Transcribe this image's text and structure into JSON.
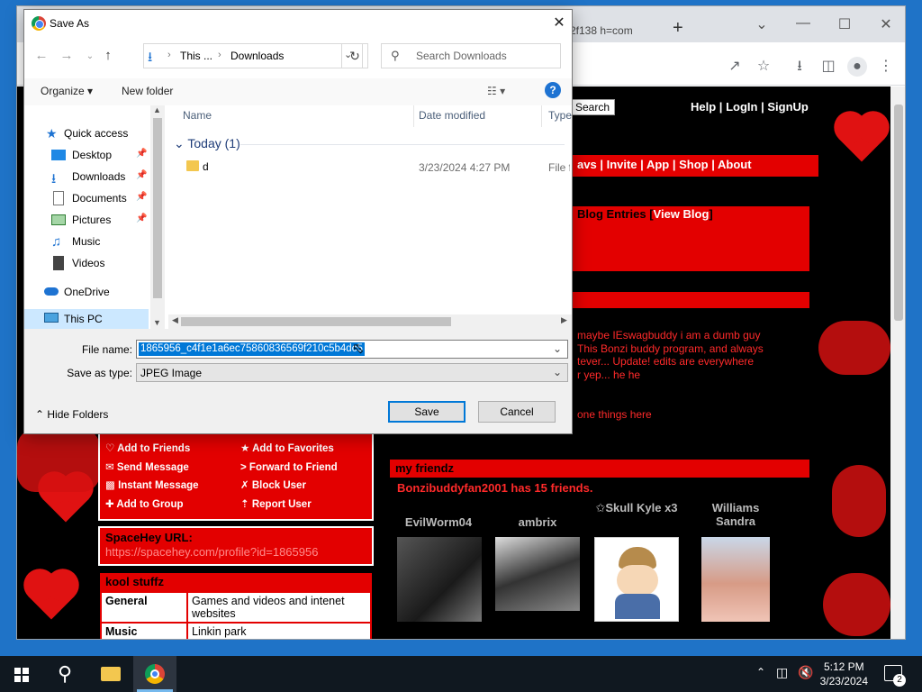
{
  "browser": {
    "tab_title": "2f138 h=com",
    "new_tab": "+"
  },
  "page": {
    "search_button": "Search",
    "top_links": [
      "Help",
      "LogIn",
      "SignUp"
    ],
    "top_sep": "|",
    "nav_links": [
      "avs",
      "Invite",
      "App",
      "Shop",
      "About"
    ],
    "blog_heading": "Blog Entries",
    "view_blog": "View Blog",
    "blurb_lines": [
      "maybe IEswagbuddy i am a dumb guy",
      "This Bonzi buddy program, and always",
      "tever... Update! edits are everywhere",
      "r yep... he he"
    ],
    "blurb_extra": "one things here",
    "contact": {
      "left": [
        "Add to Friends",
        "Send Message",
        "Instant Message",
        "Add to Group"
      ],
      "right": [
        "Add to Favorites",
        "Forward to Friend",
        "Block User",
        "Report User"
      ]
    },
    "url_box": {
      "label": "SpaceHey URL:",
      "url": "https://spacehey.com/profile?id=1865956"
    },
    "kool": {
      "heading": "kool stuffz",
      "rows": [
        {
          "key": "General",
          "value": "Games and videos and intenet websites"
        },
        {
          "key": "Music",
          "value": "Linkin park"
        }
      ]
    },
    "friends": {
      "heading": "my friendz",
      "count_text": "Bonzibuddyfan2001 has 15 friends.",
      "names": [
        "EvilWorm04",
        "ambrix",
        "✩Skull Kyle x3",
        "Williams Sandra"
      ]
    }
  },
  "dialog": {
    "title": "Save As",
    "close": "✕",
    "breadcrumb": [
      "This ...",
      "Downloads"
    ],
    "search_placeholder": "Search Downloads",
    "organize": "Organize",
    "new_folder": "New folder",
    "nav_items": [
      {
        "label": "Quick access",
        "icon": "star-icon"
      },
      {
        "label": "Desktop",
        "icon": "desktop-icon",
        "pinned": true
      },
      {
        "label": "Downloads",
        "icon": "download-icon",
        "pinned": true
      },
      {
        "label": "Documents",
        "icon": "document-icon",
        "pinned": true
      },
      {
        "label": "Pictures",
        "icon": "pictures-icon",
        "pinned": true
      },
      {
        "label": "Music",
        "icon": "music-icon"
      },
      {
        "label": "Videos",
        "icon": "videos-icon"
      },
      {
        "label": "OneDrive",
        "icon": "cloud-icon"
      },
      {
        "label": "This PC",
        "icon": "computer-icon"
      }
    ],
    "columns": [
      "Name",
      "Date modified",
      "Type"
    ],
    "group_label": "Today (1)",
    "files": [
      {
        "name": "d",
        "date": "3/23/2024 4:27 PM",
        "type": "File fo"
      }
    ],
    "file_name_label": "File name:",
    "file_name_value": "1865956_c4f1e1a6ec75860836569f210c5b4dc5",
    "save_type_label": "Save as type:",
    "save_type_value": "JPEG Image",
    "hide_folders": "Hide Folders",
    "save": "Save",
    "cancel": "Cancel"
  },
  "taskbar": {
    "time": "5:12 PM",
    "date": "3/23/2024",
    "notification_count": "2"
  },
  "colors": {
    "spacehey_red": "#e30000",
    "windows_blue": "#0078d7",
    "selection": "#0078d7"
  }
}
